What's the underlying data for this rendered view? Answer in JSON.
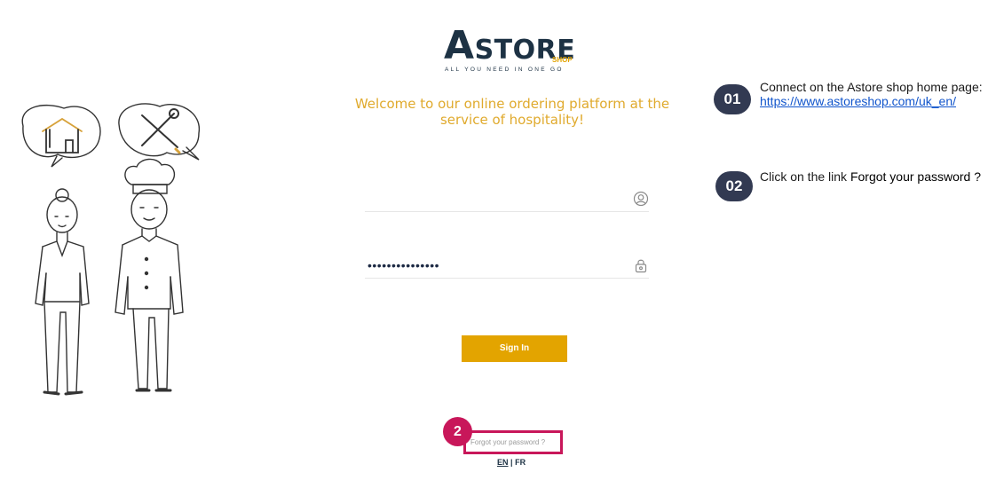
{
  "logo": {
    "initial": "A",
    "rest": "STORE",
    "sub": "SHOP",
    "tagline": "ALL YOU NEED IN ONE GO"
  },
  "welcome": "Welcome to our online ordering platform at the service of hospitality!",
  "form": {
    "password_value": "•••••••••••••••",
    "signin_label": "Sign In",
    "forgot_label": "Forgot your password ?"
  },
  "language": {
    "en": "EN",
    "separator": "|",
    "fr": "FR"
  },
  "annotation": {
    "marker": "2"
  },
  "steps": [
    {
      "number": "01",
      "text": "Connect on the Astore shop home page:",
      "link": "https://www.astoreshop.com/uk_en/"
    },
    {
      "number": "02",
      "text": "Click on the link ",
      "strong": "Forgot your password ?"
    }
  ],
  "colors": {
    "brand_navy": "#1d3244",
    "brand_gold": "#e3a400",
    "highlight": "#c8175a",
    "step_circle": "#323a52"
  },
  "icons": [
    "house-icon",
    "tools-icon",
    "user-icon",
    "lock-icon"
  ]
}
